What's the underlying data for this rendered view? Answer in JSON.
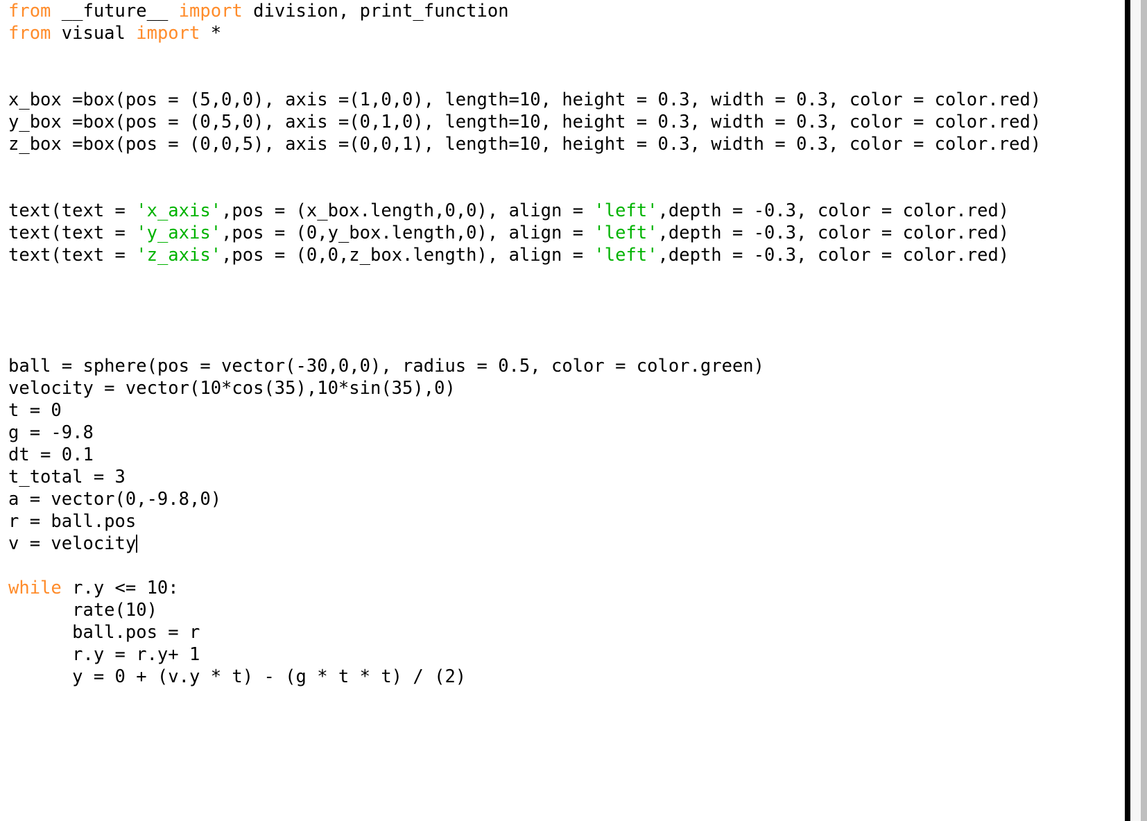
{
  "editor": {
    "language": "Python",
    "font_style": "monospace",
    "colors": {
      "background": "#ffffff",
      "default_text": "#000000",
      "keyword": "#ff8c2b",
      "string": "#00b300",
      "caret": "#000000",
      "scrollbar_border": "#000000",
      "scrollbar_track": "#f7f7f7",
      "scrollbar_thumb": "#bfbfbf"
    },
    "caret": {
      "visible": true,
      "after_text": "v = velocity",
      "line_index": 20
    },
    "lines": [
      {
        "id": 0,
        "tokens": [
          {
            "t": "from",
            "c": "kw"
          },
          {
            "t": " __future__ ",
            "c": "pln"
          },
          {
            "t": "import",
            "c": "kw"
          },
          {
            "t": " division, print_function",
            "c": "pln"
          }
        ]
      },
      {
        "id": 1,
        "tokens": [
          {
            "t": "from",
            "c": "kw"
          },
          {
            "t": " visual ",
            "c": "pln"
          },
          {
            "t": "import",
            "c": "kw"
          },
          {
            "t": " *",
            "c": "pln"
          }
        ]
      },
      {
        "id": 2,
        "tokens": []
      },
      {
        "id": 3,
        "tokens": []
      },
      {
        "id": 4,
        "tokens": [
          {
            "t": "x_box =box(pos = (5,0,0), axis =(1,0,0), length=10, height = 0.3, width = 0.3, color = color.red)",
            "c": "pln"
          }
        ]
      },
      {
        "id": 5,
        "tokens": [
          {
            "t": "y_box =box(pos = (0,5,0), axis =(0,1,0), length=10, height = 0.3, width = 0.3, color = color.red)",
            "c": "pln"
          }
        ]
      },
      {
        "id": 6,
        "tokens": [
          {
            "t": "z_box =box(pos = (0,0,5), axis =(0,0,1), length=10, height = 0.3, width = 0.3, color = color.red)",
            "c": "pln"
          }
        ]
      },
      {
        "id": 7,
        "tokens": []
      },
      {
        "id": 8,
        "tokens": []
      },
      {
        "id": 9,
        "tokens": [
          {
            "t": "text(text = ",
            "c": "pln"
          },
          {
            "t": "'x_axis'",
            "c": "str"
          },
          {
            "t": ",pos = (x_box.length,0,0), align = ",
            "c": "pln"
          },
          {
            "t": "'left'",
            "c": "str"
          },
          {
            "t": ",depth = -0.3, color = color.red)",
            "c": "pln"
          }
        ]
      },
      {
        "id": 10,
        "tokens": [
          {
            "t": "text(text = ",
            "c": "pln"
          },
          {
            "t": "'y_axis'",
            "c": "str"
          },
          {
            "t": ",pos = (0,y_box.length,0), align = ",
            "c": "pln"
          },
          {
            "t": "'left'",
            "c": "str"
          },
          {
            "t": ",depth = -0.3, color = color.red)",
            "c": "pln"
          }
        ]
      },
      {
        "id": 11,
        "tokens": [
          {
            "t": "text(text = ",
            "c": "pln"
          },
          {
            "t": "'z_axis'",
            "c": "str"
          },
          {
            "t": ",pos = (0,0,z_box.length), align = ",
            "c": "pln"
          },
          {
            "t": "'left'",
            "c": "str"
          },
          {
            "t": ",depth = -0.3, color = color.red)",
            "c": "pln"
          }
        ]
      },
      {
        "id": 12,
        "tokens": []
      },
      {
        "id": 13,
        "tokens": []
      },
      {
        "id": 14,
        "tokens": []
      },
      {
        "id": 15,
        "tokens": []
      },
      {
        "id": 16,
        "tokens": [
          {
            "t": "ball = sphere(pos = vector(-30,0,0), radius = 0.5, color = color.green)",
            "c": "pln"
          }
        ]
      },
      {
        "id": 17,
        "tokens": [
          {
            "t": "velocity = vector(10*cos(35),10*sin(35),0)",
            "c": "pln"
          }
        ]
      },
      {
        "id": 18,
        "tokens": [
          {
            "t": "t = 0",
            "c": "pln"
          }
        ]
      },
      {
        "id": 19,
        "tokens": [
          {
            "t": "g = -9.8",
            "c": "pln"
          }
        ]
      },
      {
        "id": 20,
        "tokens": [
          {
            "t": "dt = 0.1",
            "c": "pln"
          }
        ]
      },
      {
        "id": 21,
        "tokens": [
          {
            "t": "t_total = 3",
            "c": "pln"
          }
        ]
      },
      {
        "id": 22,
        "tokens": [
          {
            "t": "a = vector(0,-9.8,0)",
            "c": "pln"
          }
        ]
      },
      {
        "id": 23,
        "tokens": [
          {
            "t": "r = ball.pos",
            "c": "pln"
          }
        ]
      },
      {
        "id": 24,
        "tokens": [
          {
            "t": "v = velocity",
            "c": "pln"
          }
        ],
        "caret": true
      },
      {
        "id": 25,
        "tokens": []
      },
      {
        "id": 26,
        "tokens": [
          {
            "t": "while",
            "c": "kw"
          },
          {
            "t": " r.y <= 10:",
            "c": "pln"
          }
        ]
      },
      {
        "id": 27,
        "tokens": [
          {
            "t": "      rate(10)",
            "c": "pln"
          }
        ]
      },
      {
        "id": 28,
        "tokens": [
          {
            "t": "      ball.pos = r",
            "c": "pln"
          }
        ]
      },
      {
        "id": 29,
        "tokens": [
          {
            "t": "      r.y = r.y+ 1",
            "c": "pln"
          }
        ]
      },
      {
        "id": 30,
        "tokens": [
          {
            "t": "      y = 0 + (v.y * t) - (g * t * t) / (2)",
            "c": "pln"
          }
        ]
      }
    ]
  },
  "scrollbar": {
    "orientation": "vertical",
    "thumb_position": "full",
    "thumb_top_percent": 0,
    "thumb_height_percent": 100
  }
}
